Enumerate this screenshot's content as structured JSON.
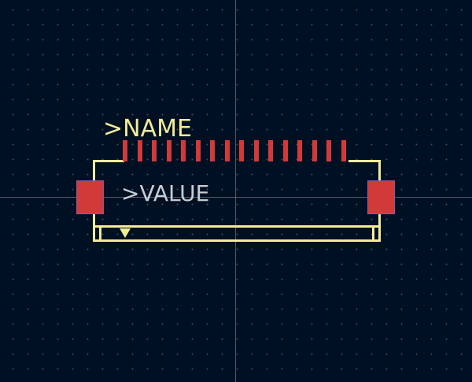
{
  "footprint": {
    "reference_label": ">NAME",
    "value_label": ">VALUE"
  },
  "colors": {
    "background": "#001023",
    "pad": "#d23a3a",
    "silkscreen": "#f2ec9a",
    "value_text": "#c6ccd4",
    "crosshair": "#8a93a3"
  }
}
